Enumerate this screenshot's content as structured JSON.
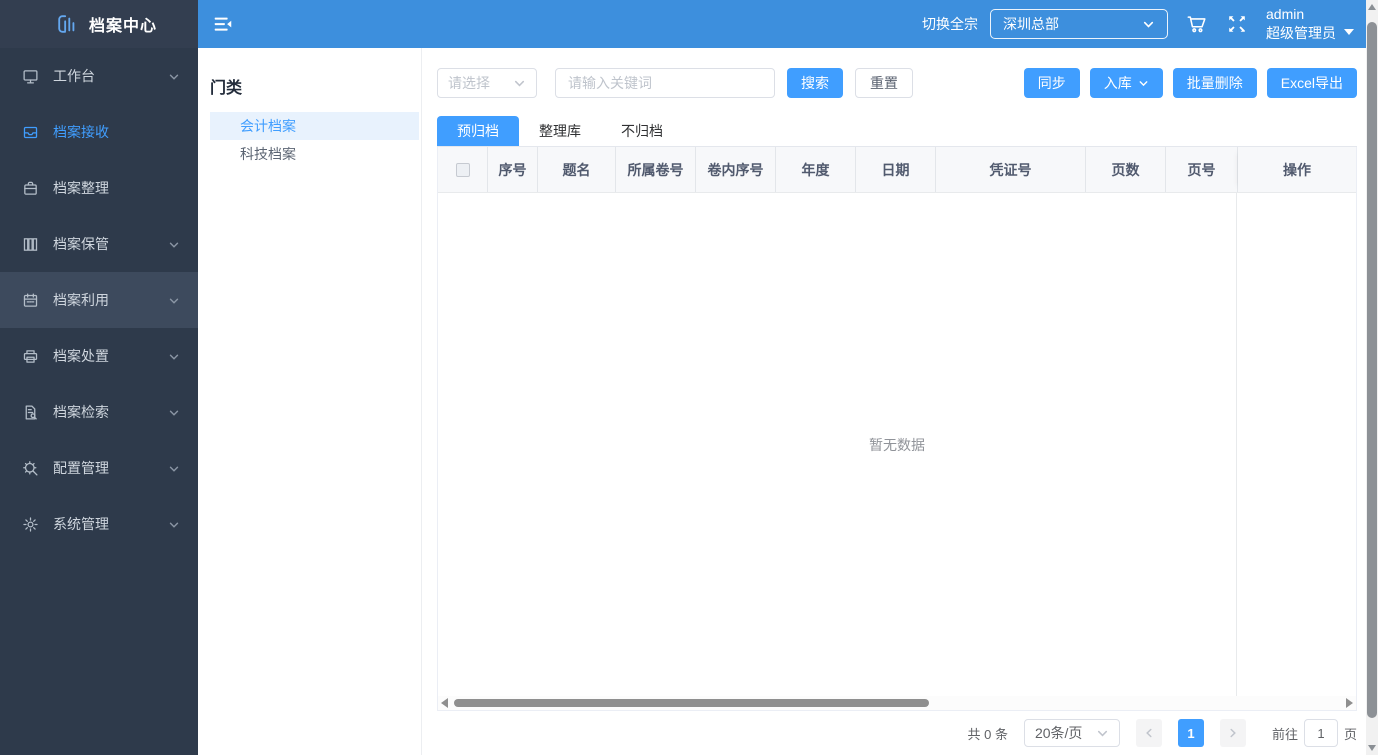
{
  "app": {
    "title": "档案中心"
  },
  "topbar": {
    "switch_label": "切换全宗",
    "org_value": "深圳总部",
    "username": "admin",
    "role": "超级管理员"
  },
  "sidebar": {
    "items": [
      {
        "label": "工作台",
        "icon": "monitor-icon",
        "has_children": true,
        "active": false
      },
      {
        "label": "档案接收",
        "icon": "inbox-icon",
        "has_children": false,
        "active": true
      },
      {
        "label": "档案整理",
        "icon": "briefcase-icon",
        "has_children": false,
        "active": false
      },
      {
        "label": "档案保管",
        "icon": "archive-shelf-icon",
        "has_children": true,
        "active": false
      },
      {
        "label": "档案利用",
        "icon": "calendar-icon",
        "has_children": true,
        "active": false
      },
      {
        "label": "档案处置",
        "icon": "printer-icon",
        "has_children": true,
        "active": false
      },
      {
        "label": "档案检索",
        "icon": "file-search-icon",
        "has_children": true,
        "active": false
      },
      {
        "label": "配置管理",
        "icon": "settings-search-icon",
        "has_children": true,
        "active": false
      },
      {
        "label": "系统管理",
        "icon": "gear-icon",
        "has_children": true,
        "active": false
      }
    ]
  },
  "category_panel": {
    "title": "门类",
    "items": [
      {
        "label": "会计档案",
        "active": true
      },
      {
        "label": "科技档案",
        "active": false
      }
    ]
  },
  "filters": {
    "field_select_placeholder": "请选择",
    "keyword_placeholder": "请输入关键词",
    "search_label": "搜索",
    "reset_label": "重置"
  },
  "toolbar": {
    "sync_label": "同步",
    "inbound_label": "入库",
    "batch_delete_label": "批量删除",
    "excel_export_label": "Excel导出"
  },
  "tabs": [
    {
      "label": "预归档",
      "active": true
    },
    {
      "label": "整理库",
      "active": false
    },
    {
      "label": "不归档",
      "active": false
    }
  ],
  "table": {
    "columns": [
      "序号",
      "题名",
      "所属卷号",
      "卷内序号",
      "年度",
      "日期",
      "凭证号",
      "页数",
      "页号",
      "操作"
    ],
    "rows": [],
    "empty_text": "暂无数据"
  },
  "pagination": {
    "total_text": "共 0 条",
    "page_size_value": "20条/页",
    "current_page": "1",
    "goto_label": "前往",
    "goto_value": "1",
    "page_unit_label": "页"
  },
  "icons": {
    "logo": "bar-chart-book",
    "collapse": "menu-fold",
    "cart": "shopping-cart",
    "fullscreen": "expand-arrows",
    "user_caret": "caret-down",
    "selects": "chevron-down"
  },
  "colors": {
    "primary": "#409eff",
    "topbar_bg": "#3d8fdd",
    "sidebar_bg": "#2e3a4b",
    "sidebar_hover_bg": "#3d4a5d",
    "sidebar_active_text": "#409eff",
    "category_active_bg": "#e8f2fd",
    "table_header_bg": "#f7f8fa",
    "empty_text_color": "#909399",
    "scrollbar_thumb": "#8d9196"
  }
}
